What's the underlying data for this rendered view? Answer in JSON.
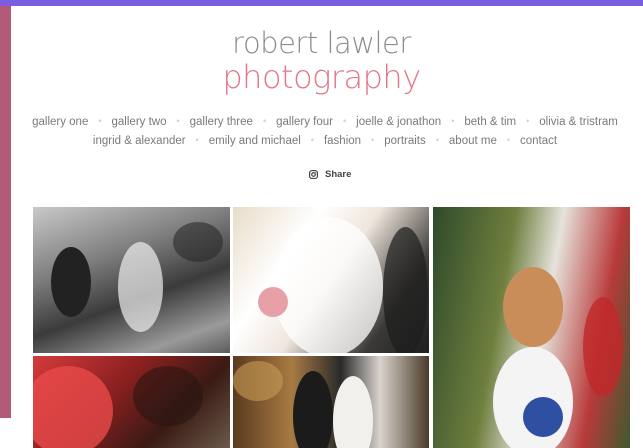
{
  "logo": {
    "line1": "robert lawler",
    "line2": "photography"
  },
  "nav": {
    "row1": [
      "gallery one",
      "gallery two",
      "gallery three",
      "gallery four",
      "joelle & jonathon",
      "beth & tim",
      "olivia & tristram"
    ],
    "row2": [
      "ingrid & alexander",
      "emily and michael",
      "fashion",
      "portraits",
      "about me",
      "contact"
    ]
  },
  "share": {
    "icon": "instagram-icon",
    "label": "Share"
  },
  "colors": {
    "top_bar": "#7a5de0",
    "left_strip": "#b35a78",
    "logo_primary": "#8d8d8d",
    "logo_accent": "#e17787"
  }
}
